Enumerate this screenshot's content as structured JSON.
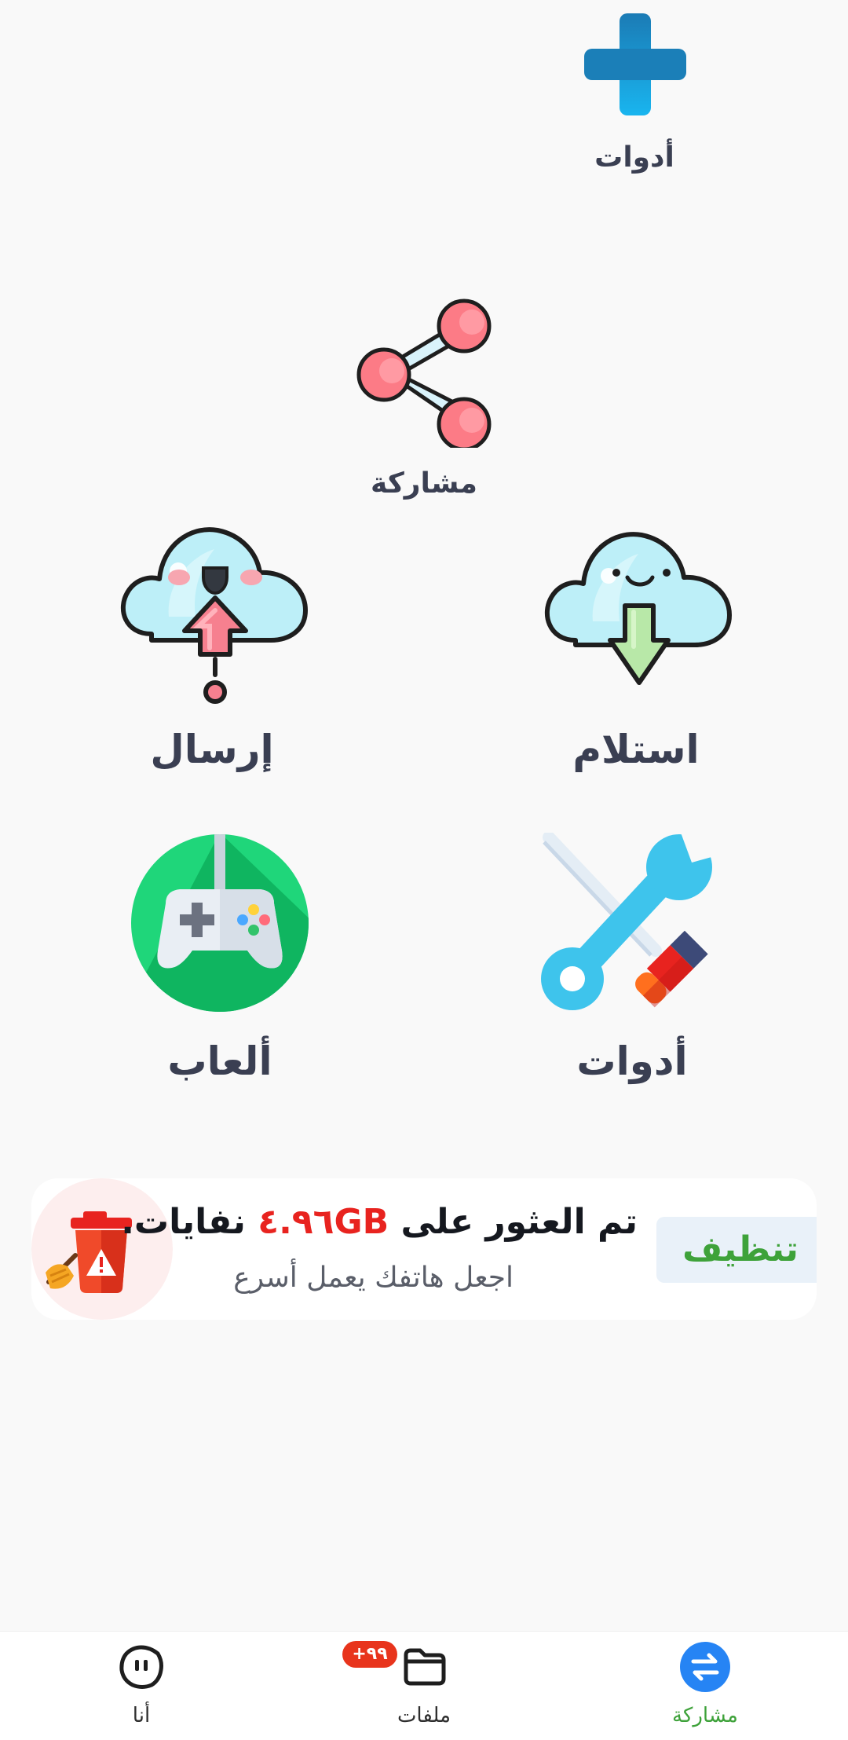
{
  "tiles": {
    "tools_top": {
      "label": "أدوات",
      "icon": "plus-icon"
    },
    "share": {
      "label": "مشاركة",
      "icon": "share-icon"
    },
    "send": {
      "label": "إرسال",
      "icon": "cloud-upload-icon"
    },
    "receive": {
      "label": "استلام",
      "icon": "cloud-download-icon"
    },
    "games": {
      "label": "ألعاب",
      "icon": "gamepad-icon"
    },
    "tools": {
      "label": "أدوات",
      "icon": "tools-icon"
    }
  },
  "cleaner": {
    "title_prefix": "تم العثور على",
    "size": "٤.٩٦GB",
    "title_suffix": "نفايات.",
    "subtitle": "اجعل هاتفك يعمل أسرع",
    "button": "تنظيف",
    "icon": "trash-icon"
  },
  "nav": {
    "me": {
      "label": "أنا",
      "icon": "smile-icon"
    },
    "files": {
      "label": "ملفات",
      "badge": "+٩٩",
      "icon": "folder-icon"
    },
    "share": {
      "label": "مشاركة",
      "icon": "transfer-icon"
    }
  },
  "colors": {
    "accent_green": "#3ea23a",
    "accent_red": "#e8231f",
    "accent_blue": "#2684f4",
    "label_color": "#3a3f52"
  }
}
